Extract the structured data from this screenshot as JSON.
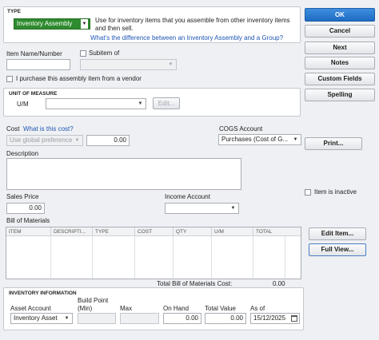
{
  "type_section": {
    "header": "TYPE",
    "selected_type": "Inventory Assembly",
    "description": "Use for inventory items that you assemble from other inventory items and then sell.",
    "help_link": "What's the difference between an Inventory Assembly and a Group?"
  },
  "item": {
    "name_label": "Item Name/Number",
    "name_value": "",
    "subitem_label": "Subitem of",
    "subitem_value": "",
    "purchase_vendor_label": "I purchase this assembly item from a vendor"
  },
  "unit_of_measure": {
    "header": "UNIT OF MEASURE",
    "um_label": "U/M",
    "um_value": "",
    "edit_label": "Edit..."
  },
  "cost": {
    "label": "Cost",
    "link": "What is this cost?",
    "method": "Use global preference",
    "value": "0.00",
    "cogs_label": "COGS Account",
    "cogs_value": "Purchases  (Cost of G...",
    "print_label": "Print...",
    "description_label": "Description",
    "description_value": ""
  },
  "sales": {
    "price_label": "Sales Price",
    "price_value": "0.00",
    "income_label": "Income Account",
    "income_value": "",
    "inactive_label": "Item is inactive"
  },
  "bom": {
    "label": "Bill of Materials",
    "columns": [
      "ITEM",
      "DESCRIPTI...",
      "TYPE",
      "COST",
      "QTY",
      "U/M",
      "TOTAL"
    ],
    "total_label": "Total Bill of Materials Cost:",
    "total_value": "0.00",
    "edit_item_label": "Edit Item...",
    "full_view_label": "Full View..."
  },
  "inventory": {
    "header": "INVENTORY INFORMATION",
    "asset_label": "Asset Account",
    "asset_value": "Inventory Asset",
    "build_point_label": "Build Point",
    "build_point_min_label": "(Min)",
    "build_point_min_value": "",
    "max_label": "Max",
    "max_value": "",
    "onhand_label": "On Hand",
    "onhand_value": "0.00",
    "total_value_label": "Total Value",
    "total_value": "0.00",
    "asof_label": "As of",
    "asof_value": "15/12/2025"
  },
  "buttons": {
    "ok": "OK",
    "cancel": "Cancel",
    "next": "Next",
    "notes": "Notes",
    "custom_fields": "Custom Fields",
    "spelling": "Spelling"
  },
  "colors": {
    "selected_type_bg": "#2e8b2e",
    "primary_button": "#2a7bd4",
    "link": "#1f56b3"
  }
}
